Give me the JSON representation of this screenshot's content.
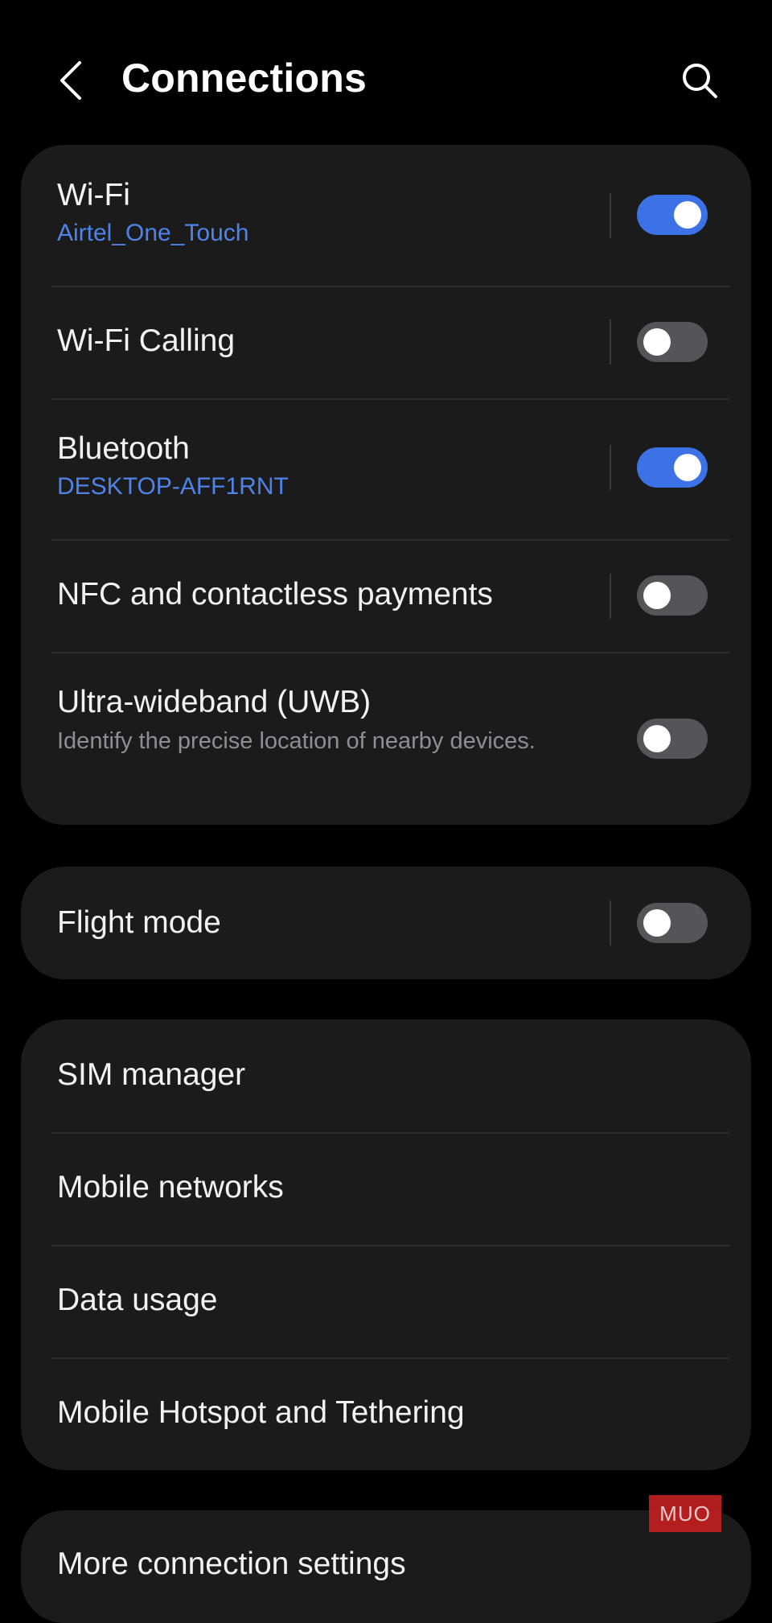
{
  "header": {
    "title": "Connections",
    "back_icon": "chevron-left-icon",
    "search_icon": "search-icon"
  },
  "group1": {
    "wifi": {
      "title": "Wi-Fi",
      "subtitle": "Airtel_One_Touch",
      "enabled": true
    },
    "wifi_calling": {
      "title": "Wi-Fi Calling",
      "enabled": false
    },
    "bluetooth": {
      "title": "Bluetooth",
      "subtitle": "DESKTOP-AFF1RNT",
      "enabled": true
    },
    "nfc": {
      "title": "NFC and contactless payments",
      "enabled": false
    },
    "uwb": {
      "title": "Ultra-wideband (UWB)",
      "subtitle": "Identify the precise location of nearby devices.",
      "enabled": false
    }
  },
  "group2": {
    "flight_mode": {
      "title": "Flight mode",
      "enabled": false
    }
  },
  "group3": {
    "items": [
      {
        "label": "SIM manager"
      },
      {
        "label": "Mobile networks"
      },
      {
        "label": "Data usage"
      },
      {
        "label": "Mobile Hotspot and Tethering"
      }
    ]
  },
  "group4": {
    "more": {
      "label": "More connection settings"
    }
  },
  "watermark": {
    "text": "MUO"
  },
  "colors": {
    "accent": "#3d72e6",
    "link_blue": "#4f83e8",
    "card_bg": "#1b1b1c",
    "background": "#000000",
    "watermark_red": "#c11f1f"
  }
}
